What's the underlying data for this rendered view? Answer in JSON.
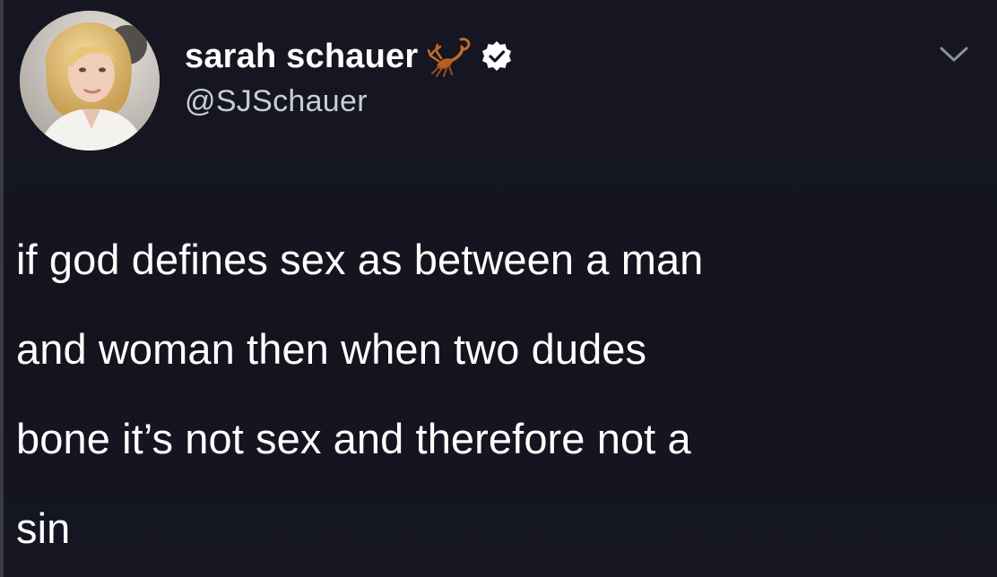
{
  "tweet": {
    "author": {
      "display_name": "sarah schauer",
      "handle": "@SJSchauer",
      "verified": true,
      "emoji_icon": "scorpion-icon"
    },
    "text_lines": [
      "if god defines sex as between a man",
      "and woman then when two dudes",
      "bone it’s not sex and therefore not a",
      "sin"
    ],
    "menu_icon": "chevron-down-icon"
  },
  "colors": {
    "background": "#14151f",
    "text": "#ffffff",
    "handle": "#c9cdd4",
    "verified_badge": "#ffffff",
    "scorpion": "#c46a2a"
  }
}
